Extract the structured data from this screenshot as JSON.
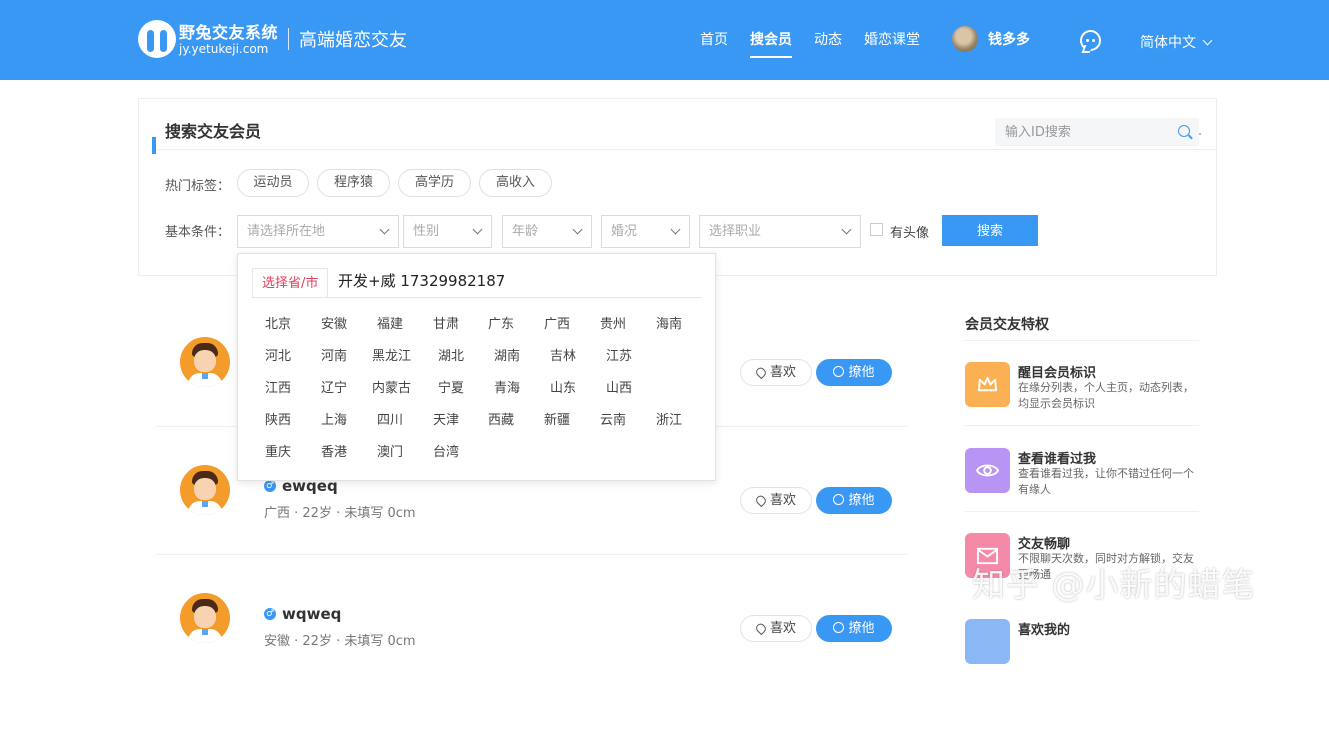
{
  "header": {
    "brand_name": "野兔交友系统",
    "brand_domain": "jy.yetukeji.com",
    "slogan": "高端婚恋交友",
    "nav": [
      {
        "label": "首页",
        "active": false
      },
      {
        "label": "搜会员",
        "active": true
      },
      {
        "label": "动态",
        "active": false
      },
      {
        "label": "婚恋课堂",
        "active": false
      }
    ],
    "user_name": "钱多多",
    "language": "简体中文",
    "colors": {
      "primary": "#3a98f5"
    }
  },
  "search": {
    "title": "搜索交友会员",
    "id_placeholder": "输入ID搜索",
    "hot_tags_label": "热门标签：",
    "hot_tags": [
      "运动员",
      "程序猿",
      "高学历",
      "高收入"
    ],
    "basic_label": "基本条件：",
    "location_placeholder": "请选择所在地",
    "gender_placeholder": "性别",
    "age_placeholder": "年龄",
    "marriage_placeholder": "婚况",
    "job_placeholder": "选择职业",
    "has_avatar_label": "有头像",
    "button_label": "搜索"
  },
  "dropdown": {
    "tab_label": "选择省/市",
    "note": "开发+威 17329982187",
    "provinces": [
      [
        "北京",
        "安徽",
        "福建",
        "甘肃",
        "广东",
        "广西",
        "贵州",
        "海南"
      ],
      [
        "河北",
        "河南",
        "黑龙江",
        "湖北",
        "湖南",
        "吉林",
        "江苏"
      ],
      [
        "江西",
        "辽宁",
        "内蒙古",
        "宁夏",
        "青海",
        "山东",
        "山西"
      ],
      [
        "陕西",
        "上海",
        "四川",
        "天津",
        "西藏",
        "新疆",
        "云南",
        "浙江"
      ],
      [
        "重庆",
        "香港",
        "澳门",
        "台湾"
      ]
    ]
  },
  "members": [
    {
      "name": "ewqeq",
      "info": "广西 · 22岁 · 未填写 0cm",
      "like_label": "喜欢",
      "chat_label": "撩他"
    },
    {
      "name": "wqweq",
      "info": "安徽 · 22岁 · 未填写 0cm",
      "like_label": "喜欢",
      "chat_label": "撩他"
    }
  ],
  "first_member": {
    "like_label": "喜欢",
    "chat_label": "撩他"
  },
  "sidebar": {
    "title": "会员交友特权",
    "items": [
      {
        "name": "醒目会员标识",
        "desc": "在缘分列表，个人主页，动态列表，均显示会员标识",
        "color": "#fbb054",
        "icon": "crown-icon"
      },
      {
        "name": "查看谁看过我",
        "desc": "查看谁看过我，让你不错过任何一个有缘人",
        "color": "#b895f5",
        "icon": "eye-icon"
      },
      {
        "name": "交友畅聊",
        "desc": "不限聊天次数，同时对方解锁，交友更畅通",
        "color": "#f589a8",
        "icon": "mail-icon"
      },
      {
        "name": "喜欢我的",
        "desc": "",
        "color": "#8ab8f5",
        "icon": "heart-icon"
      }
    ]
  },
  "watermark": "知乎 @小新的蜡笔"
}
